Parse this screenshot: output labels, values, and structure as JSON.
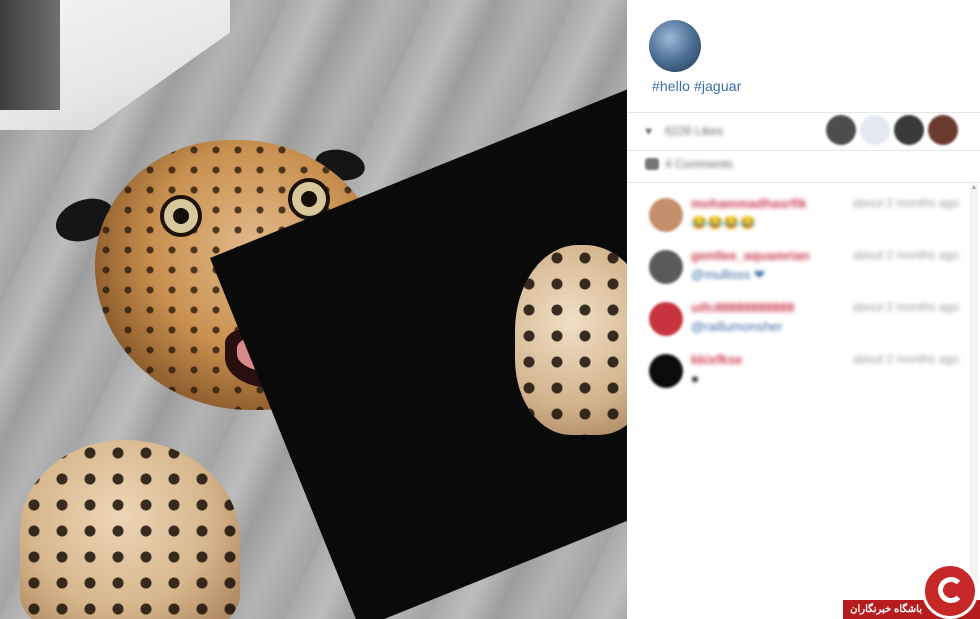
{
  "post": {
    "caption": "#hello #jaguar",
    "likes_text": "6226 Likes",
    "comments_text": "4 Comments"
  },
  "comments": [
    {
      "user": "mohammadhasrfik",
      "time": "about 2 months ago",
      "text": "😂😂😂😂",
      "avatar_color": "#c58f6b"
    },
    {
      "user": "gentlee_aquamrian",
      "time": "about 2 months ago",
      "text": "@mullisss ❤",
      "avatar_color": "#5a5a5a"
    },
    {
      "user": "utfc88888888888",
      "time": "about 2 months ago",
      "text": "@raillumonsher",
      "avatar_color": "#c7333f"
    },
    {
      "user": "kkixfkse",
      "time": "about 2 months ago",
      "text": "●",
      "avatar_color": "#0b0b0b"
    }
  ],
  "likers": [
    {
      "color": "#4d4d4d"
    },
    {
      "color": "#e3e8f2"
    },
    {
      "color": "#3a3a3a"
    },
    {
      "color": "#6b3a2e"
    }
  ],
  "watermark": {
    "text": "باشگاه خبرنگاران"
  },
  "colors": {
    "hashtag": "#3b6ea5",
    "username": "#cc3b4e",
    "watermark": "#b71c1c"
  }
}
